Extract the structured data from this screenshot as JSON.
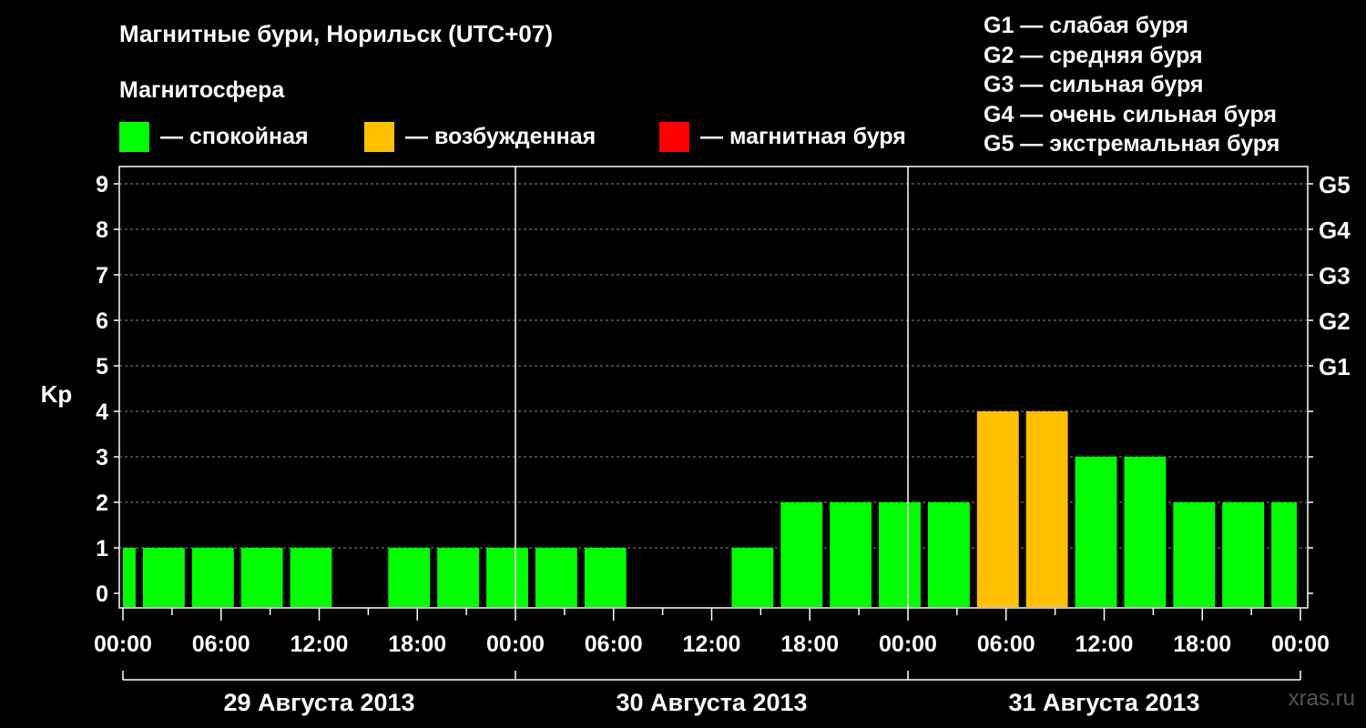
{
  "title": "Магнитные бури, Норильск (UTC+07)",
  "subtitle": "Магнитосфера",
  "legend": [
    {
      "color": "#00ff00",
      "label": "— спокойная"
    },
    {
      "color": "#ffc000",
      "label": "— возбужденная"
    },
    {
      "color": "#ff0000",
      "label": "— магнитная буря"
    }
  ],
  "g_scale": [
    "G1 — слабая буря",
    "G2 — средняя буря",
    "G3 — сильная буря",
    "G4 — очень сильная буря",
    "G5 — экстремальная буря"
  ],
  "watermark": "xras.ru",
  "chart_data": {
    "type": "bar",
    "ylabel": "Kp",
    "ylim": [
      0,
      9
    ],
    "y_ticks": [
      "0",
      "1",
      "2",
      "3",
      "4",
      "5",
      "6",
      "7",
      "8",
      "9"
    ],
    "right_ticks": [
      {
        "kp": 5,
        "label": "G1"
      },
      {
        "kp": 6,
        "label": "G2"
      },
      {
        "kp": 7,
        "label": "G3"
      },
      {
        "kp": 8,
        "label": "G4"
      },
      {
        "kp": 9,
        "label": "G5"
      }
    ],
    "x_tick_labels": [
      "00:00",
      "06:00",
      "12:00",
      "18:00",
      "00:00",
      "06:00",
      "12:00",
      "18:00",
      "00:00",
      "06:00",
      "12:00",
      "18:00",
      "00:00"
    ],
    "days": [
      "29 Августа 2013",
      "30 Августа 2013",
      "31 Августа 2013"
    ],
    "interval_hours": 3,
    "start_offset_hours": -2,
    "values": [
      1,
      1,
      1,
      1,
      1,
      0,
      1,
      1,
      1,
      1,
      1,
      0,
      0,
      1,
      2,
      2,
      2,
      2,
      4,
      4,
      3,
      3,
      2,
      2,
      2
    ],
    "colors": [
      "#00ff00",
      "#00ff00",
      "#00ff00",
      "#00ff00",
      "#00ff00",
      "#00ff00",
      "#00ff00",
      "#00ff00",
      "#00ff00",
      "#00ff00",
      "#00ff00",
      "#00ff00",
      "#00ff00",
      "#00ff00",
      "#00ff00",
      "#00ff00",
      "#00ff00",
      "#00ff00",
      "#ffc000",
      "#ffc000",
      "#00ff00",
      "#00ff00",
      "#00ff00",
      "#00ff00",
      "#00ff00"
    ],
    "grid": true
  }
}
